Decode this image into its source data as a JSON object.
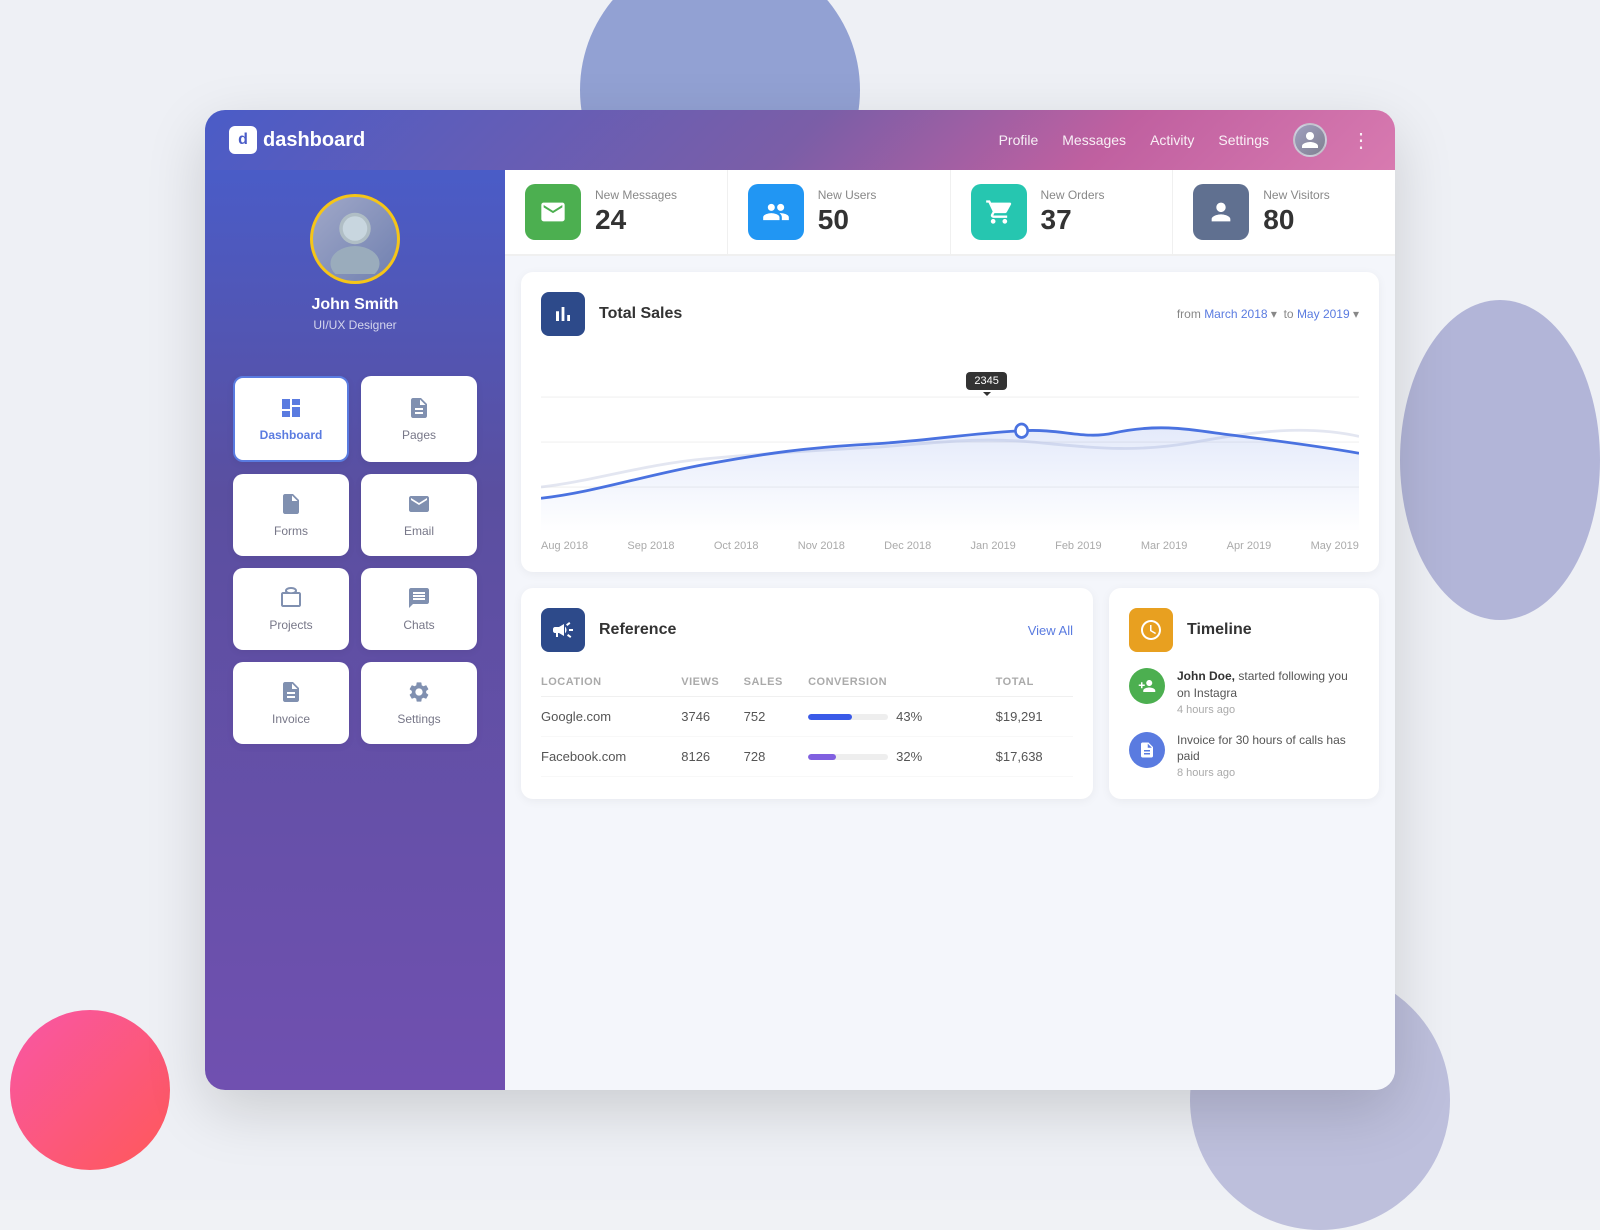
{
  "app": {
    "title": "dashboard",
    "logo_char": "d"
  },
  "header": {
    "nav_items": [
      "Profile",
      "Messages",
      "Activity",
      "Settings"
    ],
    "more_icon": "⋮"
  },
  "profile": {
    "name": "John Smith",
    "role": "UI/UX Designer"
  },
  "stats": [
    {
      "id": "messages",
      "label": "New Messages",
      "value": "24",
      "color": "#4caf50",
      "icon": "mail"
    },
    {
      "id": "users",
      "label": "New Users",
      "value": "50",
      "color": "#2196f3",
      "icon": "users"
    },
    {
      "id": "orders",
      "label": "New Orders",
      "value": "37",
      "color": "#26c6b0",
      "icon": "cart"
    },
    {
      "id": "visitors",
      "label": "New Visitors",
      "value": "80",
      "color": "#607090",
      "icon": "person"
    }
  ],
  "nav_items": [
    {
      "id": "dashboard",
      "label": "Dashboard",
      "active": true
    },
    {
      "id": "pages",
      "label": "Pages",
      "active": false
    },
    {
      "id": "forms",
      "label": "Forms",
      "active": false
    },
    {
      "id": "email",
      "label": "Email",
      "active": false
    },
    {
      "id": "projects",
      "label": "Projects",
      "active": false
    },
    {
      "id": "chats",
      "label": "Chats",
      "active": false
    },
    {
      "id": "invoice",
      "label": "Invoice",
      "active": false
    },
    {
      "id": "settings",
      "label": "Settings",
      "active": false
    }
  ],
  "chart": {
    "title": "Total Sales",
    "date_from": "March 2018",
    "date_to": "May 2019",
    "tooltip_value": "2345",
    "x_labels": [
      "Aug 2018",
      "Sep 2018",
      "Oct 2018",
      "Nov 2018",
      "Dec 2018",
      "Jan 2019",
      "Feb 2019",
      "Mar 2019",
      "Apr 2019",
      "May 2019"
    ]
  },
  "reference": {
    "title": "Reference",
    "view_all": "View All",
    "columns": [
      "LOCATION",
      "VIEWS",
      "SALES",
      "CONVERSION",
      "TOTAL"
    ],
    "rows": [
      {
        "location": "Google.com",
        "views": "3746",
        "sales": "752",
        "conversion": "43%",
        "total": "$19,291",
        "bar_pct": 55,
        "bar_color": "#3a5ae8"
      },
      {
        "location": "Facebook.com",
        "views": "8126",
        "sales": "728",
        "conversion": "32%",
        "total": "$17,638",
        "bar_pct": 35,
        "bar_color": "#8060e0"
      }
    ]
  },
  "timeline": {
    "title": "Timeline",
    "items": [
      {
        "text": "started following you on Instagra",
        "author": "John Doe,",
        "time": "4 hours ago",
        "icon": "user-plus",
        "color": "#4caf50"
      },
      {
        "text": "Invoice for 30 hours of calls has paid",
        "author": "",
        "time": "8 hours ago",
        "icon": "document",
        "color": "#5a7be0"
      }
    ]
  }
}
